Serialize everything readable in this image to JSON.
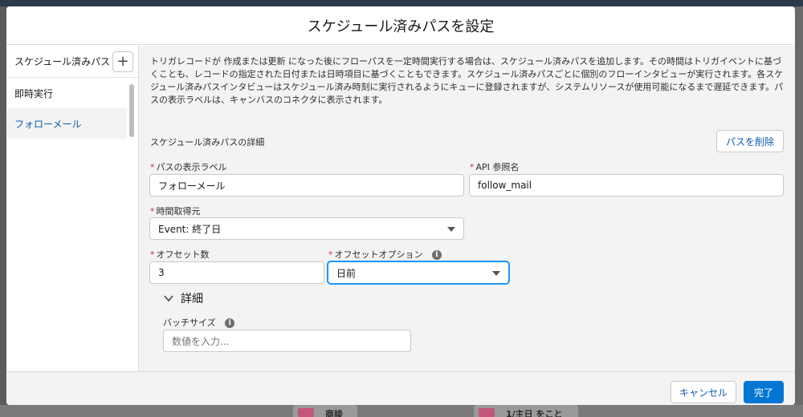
{
  "modal": {
    "title": "スケジュール済みパスを設定"
  },
  "sidebar": {
    "header_label": "スケジュール済みパス",
    "add_label": "+",
    "items": [
      {
        "label": "即時実行"
      },
      {
        "label": "フォローメール",
        "selected": true
      }
    ]
  },
  "main": {
    "description": "トリガレコードが 作成または更新 になった後にフローパスを一定時間実行する場合は、スケジュール済みパスを追加します。その時間はトリガイベントに基づくことも、レコードの指定された日付または日時項目に基づくこともできます。スケジュール済みパスごとに個別のフローインタビューが実行されます。各スケジュール済みパスインタビューはスケジュール済み時刻に実行されるようにキューに登録されますが、システムリソースが使用可能になるまで遅延できます。パスの表示ラベルは、キャンバスのコネクタに表示されます。",
    "section_title": "スケジュール済みパスの詳細",
    "delete_button": "パスを削除",
    "fields": {
      "path_label": {
        "label": "パスの表示ラベル",
        "value": "フォローメール"
      },
      "api_name": {
        "label": "API 参照名",
        "value": "follow_mail"
      },
      "time_source": {
        "label": "時間取得元",
        "value": "Event: 終了日"
      },
      "offset_number": {
        "label": "オフセット数",
        "value": "3"
      },
      "offset_option": {
        "label": "オフセットオプション",
        "value": "日前"
      }
    },
    "details_toggle": "詳細",
    "batch_size": {
      "label": "バッチサイズ",
      "placeholder": "数値を入力..."
    },
    "required_mark": "*",
    "info_glyph": "i"
  },
  "footer": {
    "cancel": "キャンセル",
    "done": "完了"
  },
  "background": {
    "card1": "商談",
    "card2": "1/主日 をこと"
  },
  "colors": {
    "brand": "#0176d3",
    "required": "#c23934",
    "link": "#0b5cab",
    "focus": "#1b96ff"
  }
}
